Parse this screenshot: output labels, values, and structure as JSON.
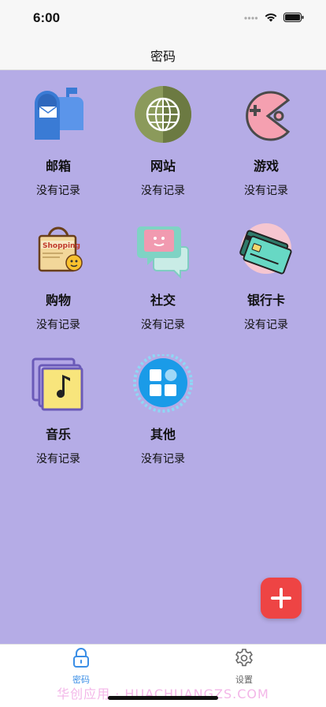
{
  "status_bar": {
    "time": "6:00"
  },
  "nav": {
    "title": "密码"
  },
  "categories": [
    {
      "name": "邮箱",
      "status": "没有记录",
      "icon": "mailbox-icon"
    },
    {
      "name": "网站",
      "status": "没有记录",
      "icon": "globe-icon"
    },
    {
      "name": "游戏",
      "status": "没有记录",
      "icon": "game-icon"
    },
    {
      "name": "购物",
      "status": "没有记录",
      "icon": "shopping-bag-icon"
    },
    {
      "name": "社交",
      "status": "没有记录",
      "icon": "chat-icon"
    },
    {
      "name": "银行卡",
      "status": "没有记录",
      "icon": "bank-card-icon"
    },
    {
      "name": "音乐",
      "status": "没有记录",
      "icon": "music-icon"
    },
    {
      "name": "其他",
      "status": "没有记录",
      "icon": "apps-icon"
    }
  ],
  "fab": {
    "icon": "plus-icon"
  },
  "tabs": [
    {
      "label": "密码",
      "icon": "lock-icon",
      "active": true
    },
    {
      "label": "设置",
      "icon": "gear-icon",
      "active": false
    }
  ],
  "watermark": "华创应用 · HUACHUANGZS.COM",
  "colors": {
    "background": "#b5ace6",
    "active_tab": "#3a8ee6",
    "fab": "#ee4444"
  }
}
